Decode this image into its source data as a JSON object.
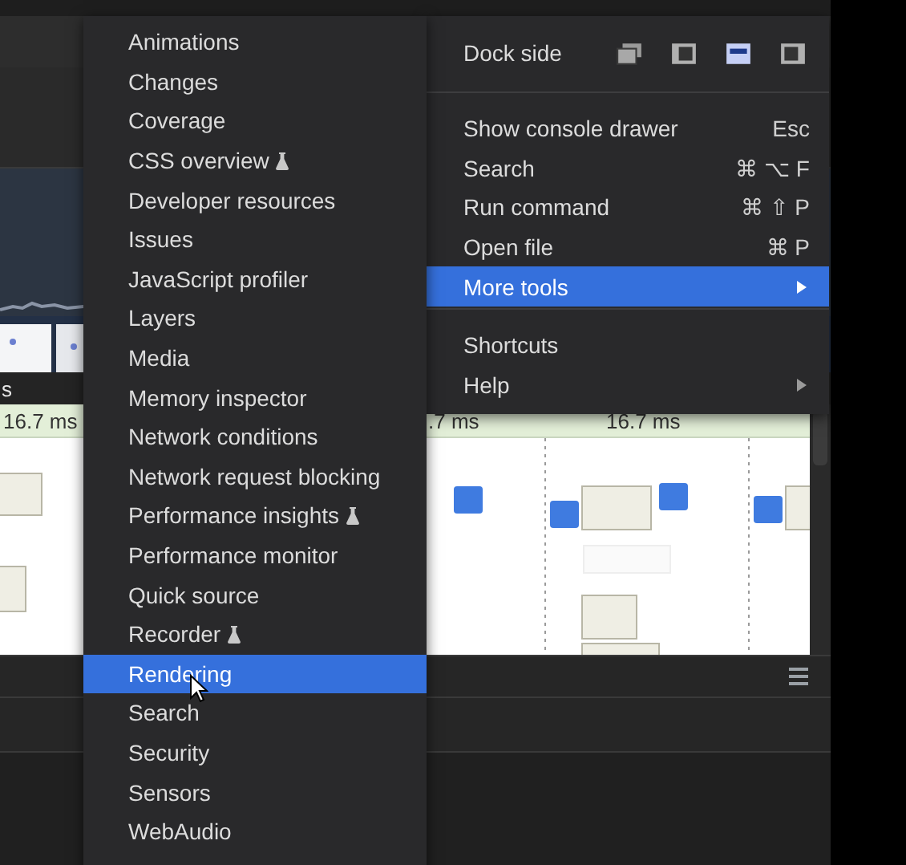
{
  "timeline": {
    "section_label": "s",
    "frame_times": [
      {
        "text": "16.7 ms"
      },
      {
        "text": ".7 ms"
      },
      {
        "text": "16.7 ms"
      }
    ]
  },
  "main_menu": {
    "dock_side": {
      "label": "Dock side",
      "options": [
        {
          "kind": "undock",
          "selected": false
        },
        {
          "kind": "left",
          "selected": false
        },
        {
          "kind": "bottom",
          "selected": true
        },
        {
          "kind": "right",
          "selected": false
        }
      ]
    },
    "groups": [
      [
        {
          "label": "Show console drawer",
          "shortcut": "Esc",
          "submenu": false,
          "selected": false
        },
        {
          "label": "Search",
          "shortcut": "⌘ ⌥ F",
          "submenu": false,
          "selected": false
        },
        {
          "label": "Run command",
          "shortcut": "⌘ ⇧ P",
          "submenu": false,
          "selected": false
        },
        {
          "label": "Open file",
          "shortcut": "⌘ P",
          "submenu": false,
          "selected": false
        },
        {
          "label": "More tools",
          "submenu": true,
          "selected": true
        }
      ],
      [
        {
          "label": "Shortcuts",
          "submenu": false,
          "selected": false
        },
        {
          "label": "Help",
          "submenu": true,
          "selected": false
        }
      ]
    ]
  },
  "more_tools_menu": {
    "items": [
      {
        "label": "Animations",
        "experimental": false,
        "selected": false
      },
      {
        "label": "Changes",
        "experimental": false,
        "selected": false
      },
      {
        "label": "Coverage",
        "experimental": false,
        "selected": false
      },
      {
        "label": "CSS overview",
        "experimental": true,
        "selected": false
      },
      {
        "label": "Developer resources",
        "experimental": false,
        "selected": false
      },
      {
        "label": "Issues",
        "experimental": false,
        "selected": false
      },
      {
        "label": "JavaScript profiler",
        "experimental": false,
        "selected": false
      },
      {
        "label": "Layers",
        "experimental": false,
        "selected": false
      },
      {
        "label": "Media",
        "experimental": false,
        "selected": false
      },
      {
        "label": "Memory inspector",
        "experimental": false,
        "selected": false
      },
      {
        "label": "Network conditions",
        "experimental": false,
        "selected": false
      },
      {
        "label": "Network request blocking",
        "experimental": false,
        "selected": false
      },
      {
        "label": "Performance insights",
        "experimental": true,
        "selected": false
      },
      {
        "label": "Performance monitor",
        "experimental": false,
        "selected": false
      },
      {
        "label": "Quick source",
        "experimental": false,
        "selected": false
      },
      {
        "label": "Recorder",
        "experimental": true,
        "selected": false
      },
      {
        "label": "Rendering",
        "experimental": false,
        "selected": true
      },
      {
        "label": "Search",
        "experimental": false,
        "selected": false
      },
      {
        "label": "Security",
        "experimental": false,
        "selected": false
      },
      {
        "label": "Sensors",
        "experimental": false,
        "selected": false
      },
      {
        "label": "WebAudio",
        "experimental": false,
        "selected": false
      }
    ]
  }
}
